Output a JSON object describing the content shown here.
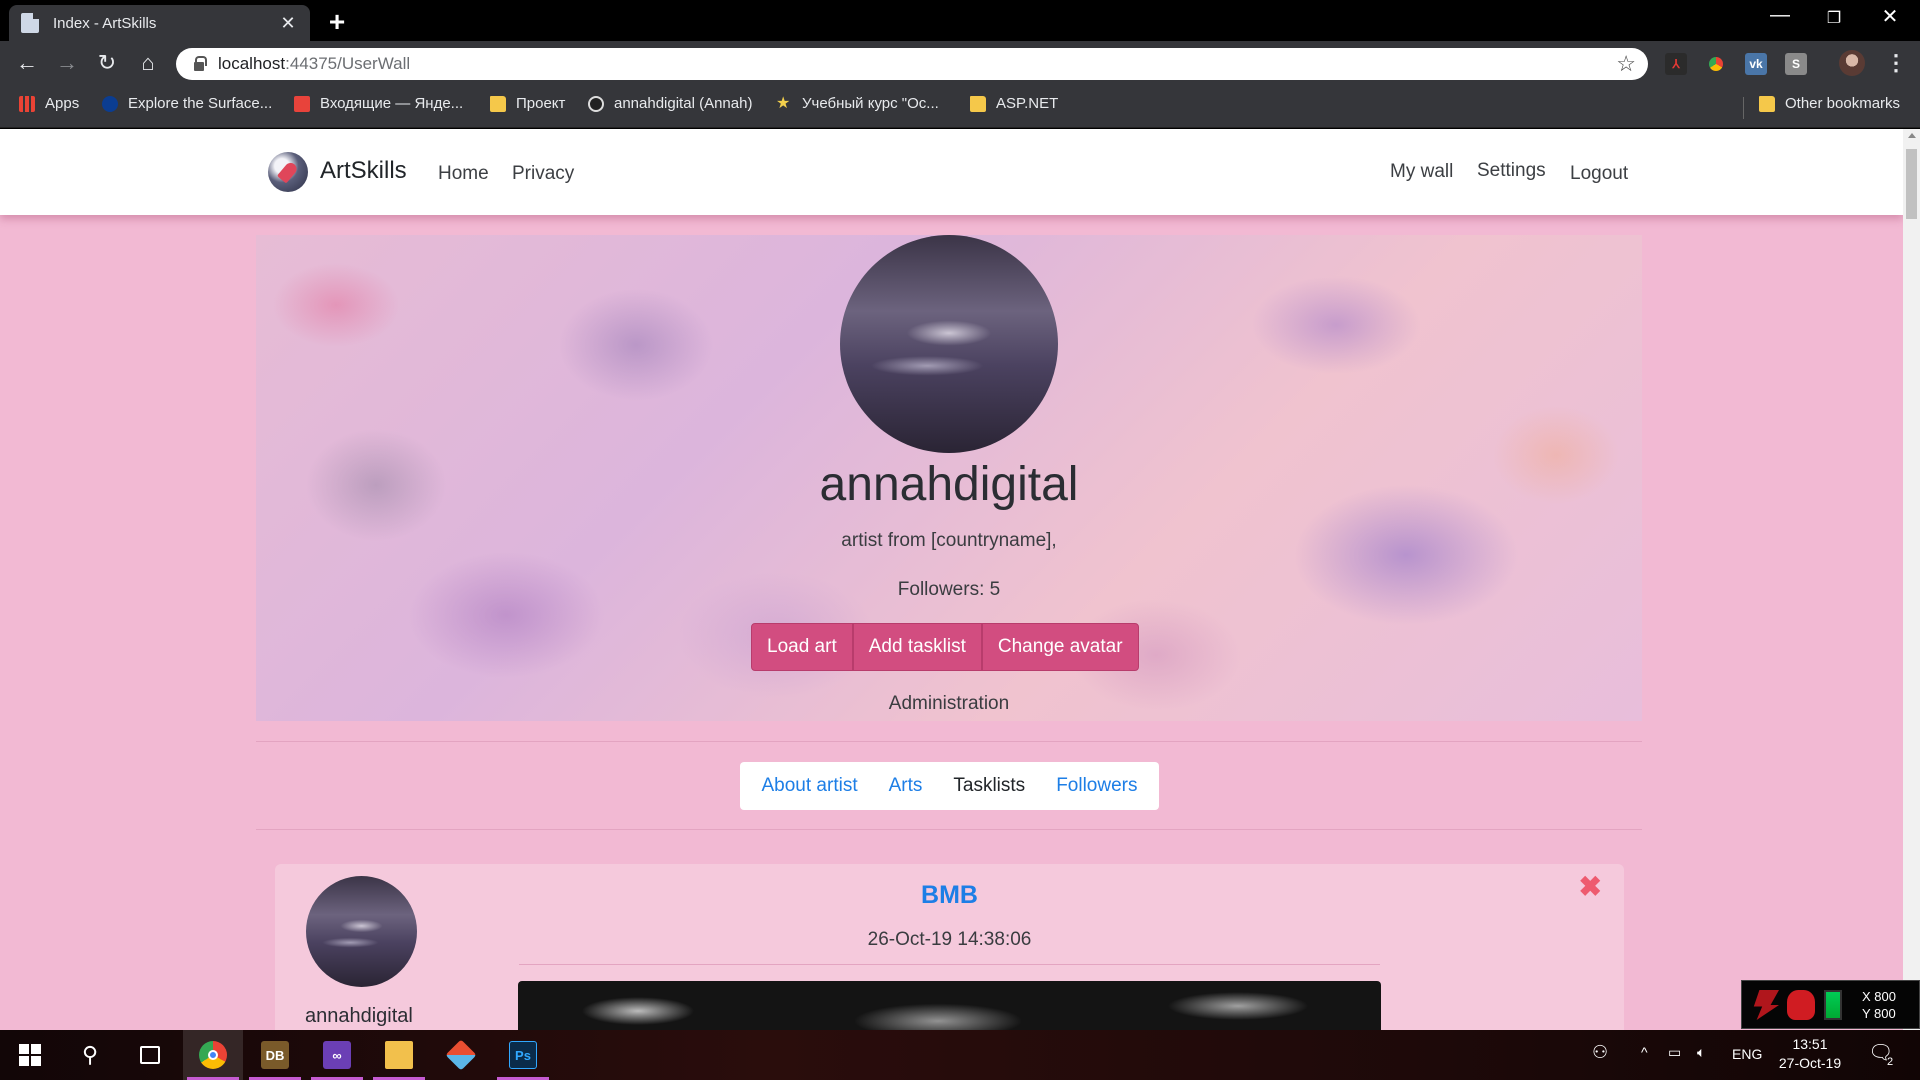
{
  "browser": {
    "tab_title": "Index - ArtSkills",
    "new_tab_label": "+",
    "url_host": "localhost",
    "url_path": ":44375/UserWall",
    "bookmarks": [
      {
        "label": "Apps",
        "icon": "apps-grid-icon"
      },
      {
        "label": "Explore the Surface...",
        "icon": "nasa-icon"
      },
      {
        "label": "Входящие — Янде...",
        "icon": "mail-icon"
      },
      {
        "label": "Проект",
        "icon": "folder-icon"
      },
      {
        "label": "annahdigital (Annah)",
        "icon": "github-icon"
      },
      {
        "label": "Учебный курс \"Ос...",
        "icon": "star-icon"
      },
      {
        "label": "ASP.NET",
        "icon": "folder-icon"
      }
    ],
    "other_bookmarks": "Other bookmarks",
    "extensions": [
      "pdf-icon",
      "chrome-ext-icon",
      "vk-icon",
      "s-ext-icon"
    ]
  },
  "site": {
    "brand": "ArtSkills",
    "nav_left": [
      "Home",
      "Privacy"
    ],
    "nav_right": [
      "My wall",
      "Settings",
      "Logout"
    ]
  },
  "profile": {
    "username": "annahdigital",
    "bio": "artist from [countryname],",
    "followers": "Followers: 5",
    "buttons": [
      "Load art",
      "Add tasklist",
      "Change avatar"
    ],
    "admin_link": "Administration",
    "accent": "#d24d80",
    "page_bg": "#f2b9d3"
  },
  "tabs": [
    {
      "label": "About artist",
      "active": false
    },
    {
      "label": "Arts",
      "active": false
    },
    {
      "label": "Tasklists",
      "active": true
    },
    {
      "label": "Followers",
      "active": false
    }
  ],
  "tasklist": {
    "title": "BMB",
    "date": "26-Oct-19 14:38:06",
    "author": "annahdigital",
    "delete_icon": "close-x-icon"
  },
  "taskbar": {
    "apps": [
      "chrome-icon",
      "dosbox-icon",
      "visual-studio-icon",
      "file-explorer-icon",
      "git-icon",
      "photoshop-icon"
    ],
    "language": "ENG",
    "time": "13:51",
    "date": "27-Oct-19",
    "notification_count": "2"
  },
  "overlay": {
    "x": "X 800",
    "y": "Y 800"
  }
}
